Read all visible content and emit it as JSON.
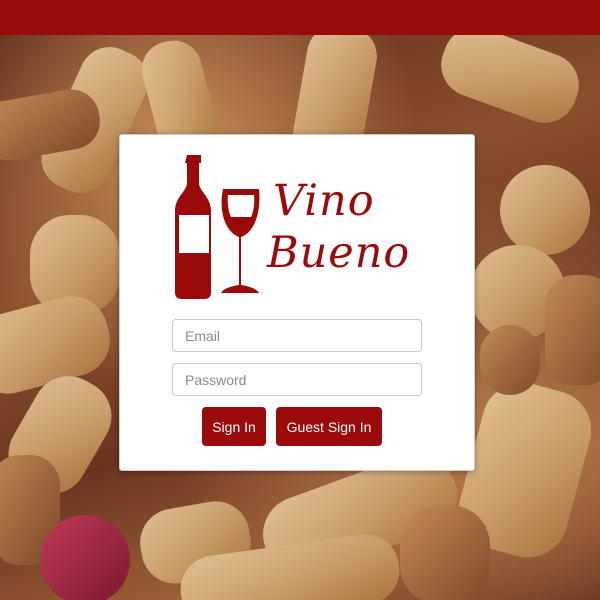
{
  "brand": {
    "name_line1": "Vino",
    "name_line2": "Bueno",
    "icon": "wine-bottle-and-glass-icon",
    "color": "#9b0a0a"
  },
  "login": {
    "email_placeholder": "Email",
    "password_placeholder": "Password",
    "sign_in_label": "Sign In",
    "guest_sign_in_label": "Guest Sign In"
  },
  "colors": {
    "topbar": "#9b0a0a",
    "button": "#9b0a0a",
    "card": "#ffffff"
  }
}
